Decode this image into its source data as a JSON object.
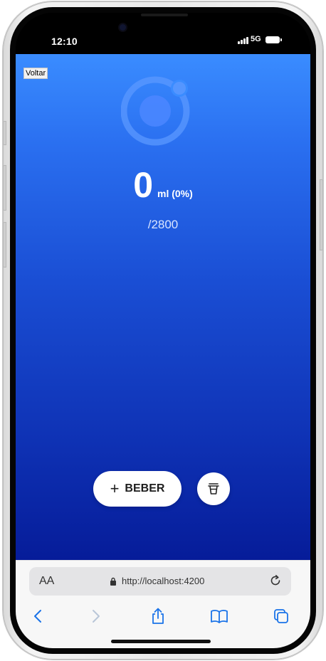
{
  "status_bar": {
    "time": "12:10",
    "network": "5G"
  },
  "app": {
    "back_label": "Voltar",
    "logo_icon": "ionic-logo-icon",
    "intake_value": "0",
    "intake_unit": "ml (0%)",
    "goal": "/2800",
    "drink_button": {
      "icon": "plus-icon",
      "label": "BEBER"
    },
    "reset_button": {
      "icon": "cup-icon"
    },
    "colors": {
      "gradient_top": "#3a8cff",
      "gradient_bottom": "#061c99",
      "button_bg": "#ffffff"
    }
  },
  "browser": {
    "text_size_label": "AA",
    "url": "http://localhost:4200",
    "toolbar": [
      "back-icon",
      "forward-icon",
      "share-icon",
      "bookmarks-icon",
      "tabs-icon"
    ],
    "accent": "#1a73e8"
  }
}
